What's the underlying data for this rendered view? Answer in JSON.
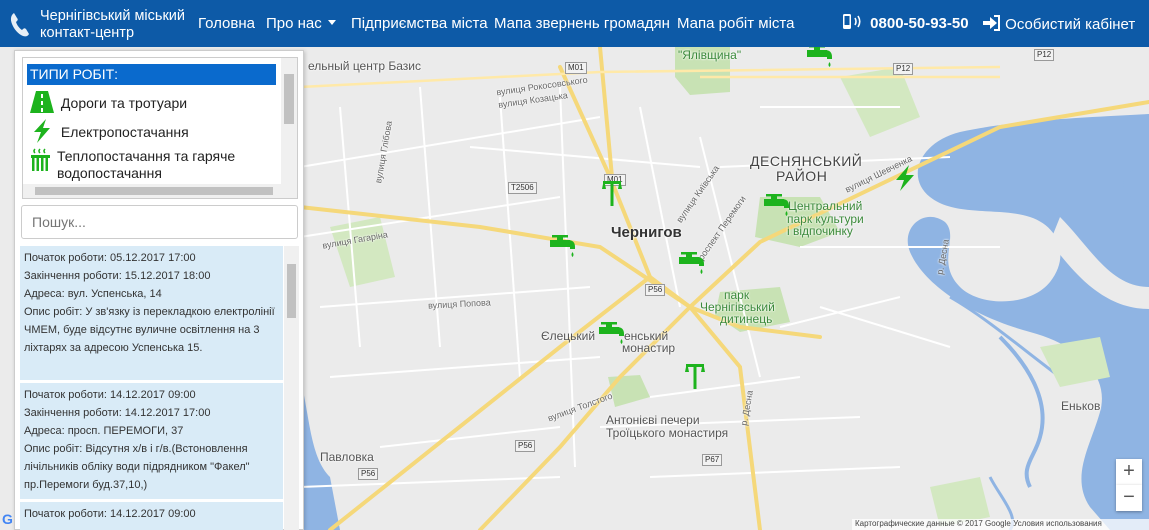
{
  "header": {
    "brand_line1": "Чернігівський міський",
    "brand_line2": "контакт-центр",
    "nav": {
      "home": "Головна",
      "about": "Про нас",
      "enterprises": "Підприємства міста",
      "appeals_map": "Мапа звернень громадян",
      "works_map": "Мапа робіт міста"
    },
    "phone": "0800-50-93-50",
    "cabinet": "Особистий кабінет"
  },
  "sidebar": {
    "types_title": "ТИПИ РОБІТ:",
    "types": [
      {
        "label": "Дороги та тротуари",
        "icon": "road-icon"
      },
      {
        "label": "Електропостачання",
        "icon": "lightning-icon"
      },
      {
        "label": "Теплопостачання та гаряче водопостачання",
        "icon": "radiator-icon"
      }
    ],
    "search_placeholder": "Пошук...",
    "jobs": [
      {
        "start": "Початок роботи: 05.12.2017 17:00",
        "end": "Закінчення роботи: 15.12.2017 18:00",
        "address": "Адреса: вул. Успенська, 14",
        "desc": "Опис робіт: У зв'язку із перекладкою електролінії ЧМЕМ, буде відсутнє вуличне освітлення на 3 ліхтарях за адресою Успенська 15."
      },
      {
        "start": "Початок роботи: 14.12.2017 09:00",
        "end": "Закінчення роботи: 14.12.2017 17:00",
        "address": "Адреса: просп. ПЕРЕМОГИ, 37",
        "desc": "Опис робіт: Відсутня х/в і г/в.(Встоновлення лічільників обліку води підрядником \"Факел\" пр.Перемоги буд.37,10,)"
      },
      {
        "start": "Початок роботи: 14.12.2017 09:00"
      }
    ]
  },
  "map": {
    "labels": {
      "center_basis": "ельный центр Базис",
      "yalivshchyna": "\"Ялівщина\"",
      "desna_district_1": "ДЕСНЯНСЬКИЙ",
      "desna_district_2": "РАЙОН",
      "park_1": "Центральний",
      "park_2": "парк культури",
      "park_3": "і відпочинку",
      "city": "Чернигов",
      "detinets_1": "парк",
      "detinets_2": "Чернігівський",
      "detinets_3": "дитинець",
      "yeletsky_1": "Єлецький",
      "yeletsky_2": "енський",
      "yeletsky_3": "монастир",
      "caves_1": "Антонієві печери",
      "caves_2": "Троїцького монастиря",
      "pavlovka": "Павловка",
      "enkov": "Еньков",
      "st_glibova": "вулиця Глібова",
      "st_kozatska": "вулиця Козацька",
      "st_rokosovskoho": "вулиця Рокосовського",
      "st_shevchenka": "вулиця Шевченка",
      "st_gagarina": "вулиця Гагаріна",
      "st_kyivska": "вулиця Київська",
      "st_peremohy": "проспект Перемоги",
      "st_popova": "вулиця Попова",
      "st_tolstoho": "вулиця Толстого",
      "st_desna": "р. Десна",
      "st_desna2": "р. Десна"
    },
    "shields": {
      "m01a": "M01",
      "m01b": "M01",
      "t2506": "T2506",
      "p56a": "P56",
      "p56b": "P56",
      "p56c": "P56",
      "p67": "P67",
      "p12a": "P12",
      "p12b": "P12"
    },
    "zoom_in": "+",
    "zoom_out": "−",
    "attribution": "Картографические данные © 2017 Google   Условия использования",
    "logo": "G",
    "markers": [
      {
        "type": "water-tap"
      },
      {
        "type": "water-tap"
      },
      {
        "type": "water-tap"
      },
      {
        "type": "water-tap"
      },
      {
        "type": "water-tap"
      },
      {
        "type": "street-light"
      },
      {
        "type": "street-light"
      },
      {
        "type": "lightning"
      }
    ]
  },
  "colors": {
    "navbar": "#0d5aa7",
    "type_title_bg": "#0a6acd",
    "job_bg": "#d9ebf7",
    "water": "#8fb4e3",
    "marker": "#1db31d"
  }
}
